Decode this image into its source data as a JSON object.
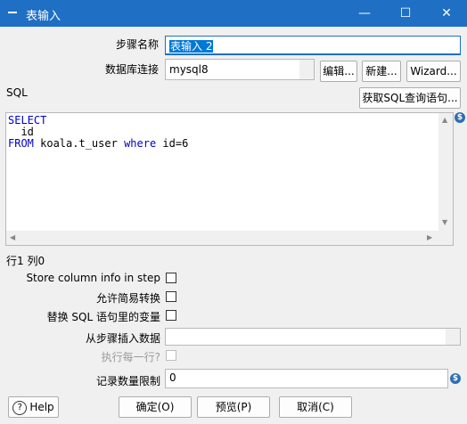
{
  "window": {
    "title": "表输入",
    "minimize": "—",
    "maximize": "☐",
    "close": "✕"
  },
  "form": {
    "step_name_label": "步骤名称",
    "step_name_value": "表输入 2",
    "db_connection_label": "数据库连接",
    "db_connection_value": "mysql8",
    "edit_button": "编辑...",
    "new_button": "新建...",
    "wizard_button": "Wizard...",
    "sql_label": "SQL",
    "get_sql_button": "获取SQL查询语句...",
    "sql_lines": {
      "line1_kw": "SELECT",
      "line2": "  id",
      "line3_kw1": "FROM",
      "line3_mid": " koala.t_user ",
      "line3_kw2": "where",
      "line3_end": " id=6"
    },
    "cursor_position": "行1 列0",
    "store_column_info_label": "Store column info in step",
    "allow_lazy_conversion_label": "允许简易转换",
    "replace_variables_label": "替换 SQL 语句里的变量",
    "insert_data_from_step_label": "从步骤插入数据",
    "insert_data_from_step_value": "",
    "execute_each_row_label": "执行每一行?",
    "limit_size_label": "记录数量限制",
    "limit_size_value": "0",
    "variable_icon": "$"
  },
  "footer": {
    "help_button": "Help",
    "ok_button": "确定(O)",
    "preview_button": "预览(P)",
    "cancel_button": "取消(C)"
  }
}
